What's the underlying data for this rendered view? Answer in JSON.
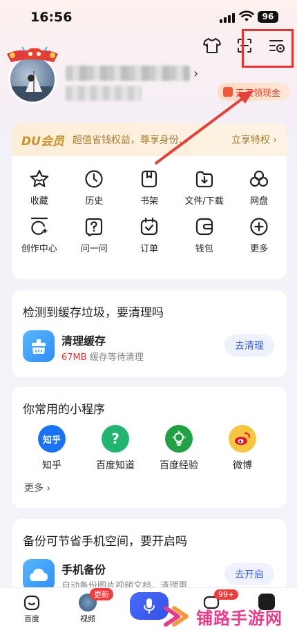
{
  "status_bar": {
    "time": "16:56",
    "battery": "96"
  },
  "profile": {
    "cash_label": "天天领现金"
  },
  "du_vip": {
    "logo": "DU会员",
    "promo": "超值省钱权益，尊享身份...",
    "link": "立享特权 ›"
  },
  "grid_items": [
    {
      "label": "收藏",
      "icon": "star-icon"
    },
    {
      "label": "历史",
      "icon": "clock-icon"
    },
    {
      "label": "书架",
      "icon": "bookshelf-icon"
    },
    {
      "label": "文件/下载",
      "icon": "download-icon"
    },
    {
      "label": "网盘",
      "icon": "cloud-disk-icon"
    },
    {
      "label": "创作中心",
      "icon": "creation-icon"
    },
    {
      "label": "问一问",
      "icon": "question-icon"
    },
    {
      "label": "订单",
      "icon": "order-icon"
    },
    {
      "label": "钱包",
      "icon": "wallet-icon"
    },
    {
      "label": "更多",
      "icon": "plus-circle-icon"
    }
  ],
  "cache_card": {
    "title": "检测到缓存垃圾，要清理吗",
    "item_title": "清理缓存",
    "size": "67MB",
    "size_note": "缓存等待清理",
    "action": "去清理"
  },
  "mini_programs": {
    "title": "你常用的小程序",
    "items": [
      {
        "label": "知乎",
        "icon_text": "知乎",
        "color": "#1a72f5"
      },
      {
        "label": "百度知道",
        "icon_text": "?",
        "color": "#22b572"
      },
      {
        "label": "百度经验",
        "icon_text": "",
        "color": "#21a146"
      },
      {
        "label": "微博",
        "icon_text": "",
        "color": "#f6c541"
      }
    ],
    "more": "更多 ›"
  },
  "backup_card": {
    "title": "备份可节省手机空间，要开启吗",
    "item_title": "手机备份",
    "item_sub": "自动备份图片视频文档，清理更...",
    "action": "去开启"
  },
  "bottom_nav": {
    "home": "百度",
    "video": "视频",
    "video_badge": "更新",
    "msg_badge": "99+"
  },
  "watermark": "铺路手游网"
}
